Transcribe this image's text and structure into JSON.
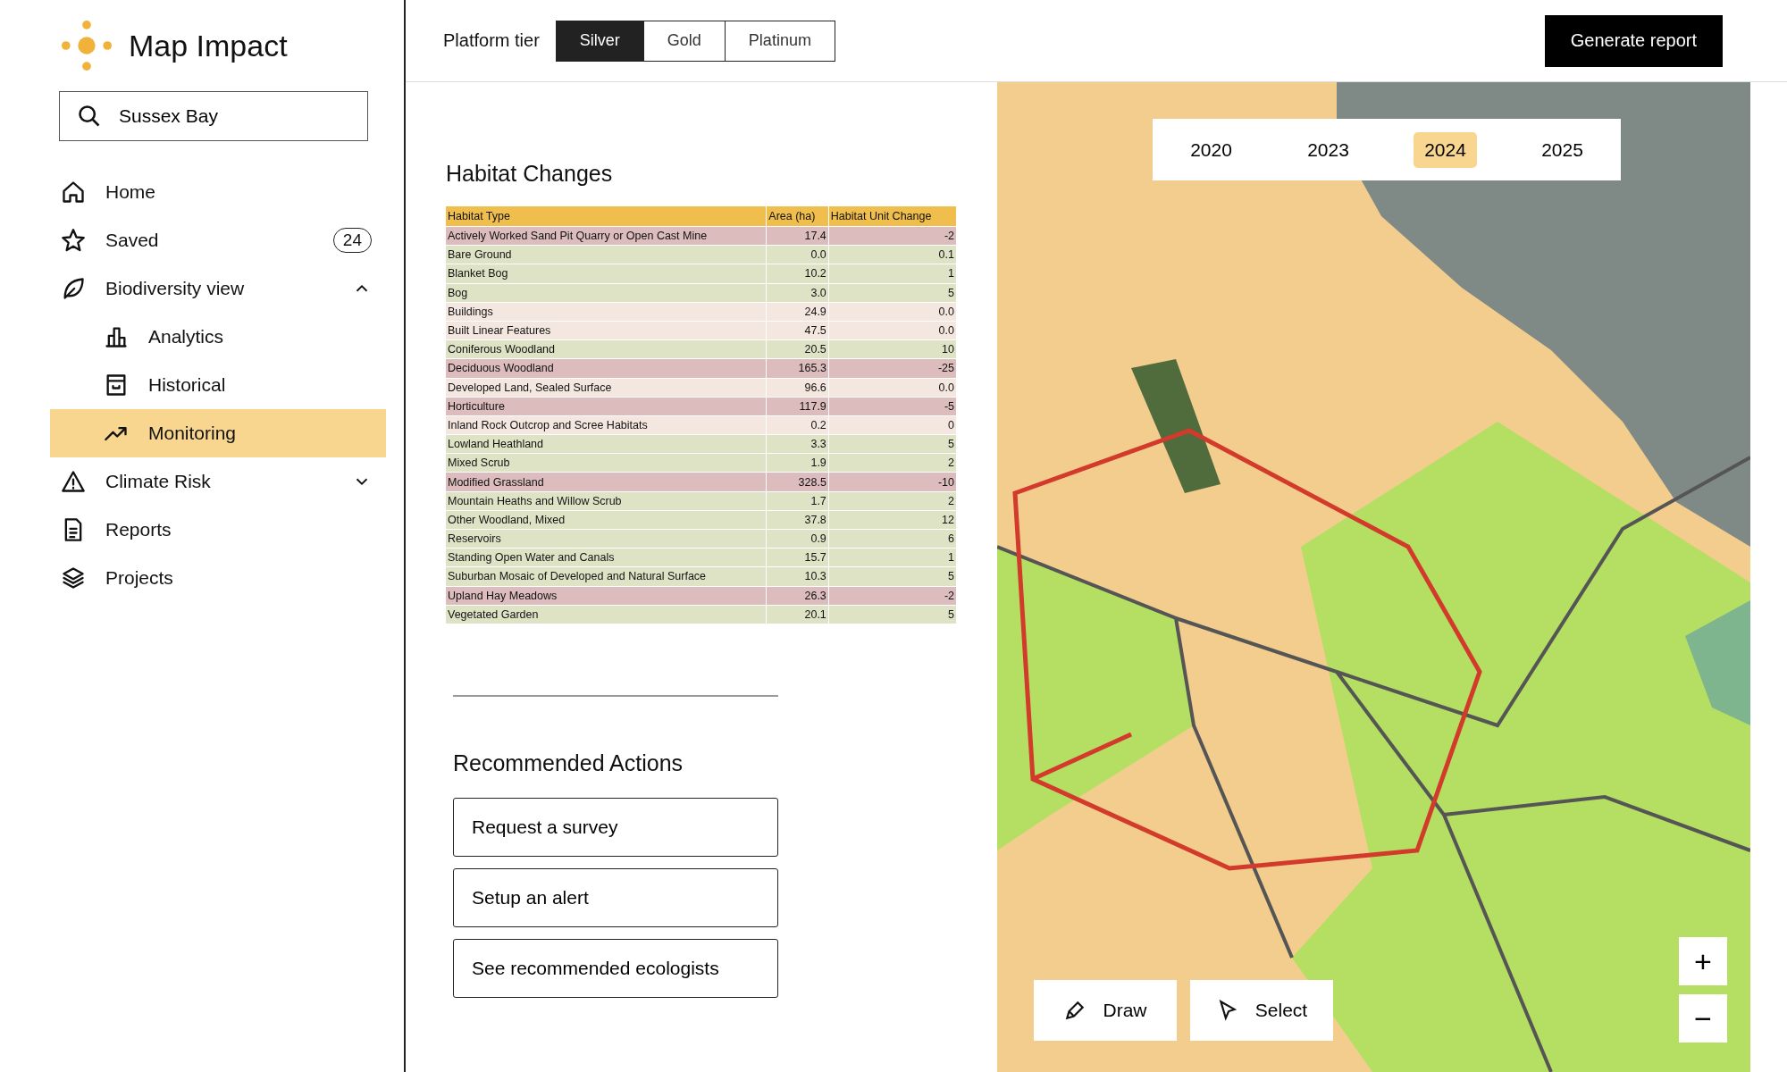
{
  "app": {
    "name": "Map Impact"
  },
  "search": {
    "value": "Sussex Bay"
  },
  "nav": [
    {
      "label": "Home",
      "selected": false
    },
    {
      "label": "Saved",
      "badge": "24",
      "selected": false
    },
    {
      "label": "Biodiversity view",
      "expanded": true,
      "selected": false,
      "children": [
        {
          "label": "Analytics",
          "selected": false
        },
        {
          "label": "Historical",
          "selected": false
        },
        {
          "label": "Monitoring",
          "selected": true
        }
      ]
    },
    {
      "label": "Climate Risk",
      "expanded": false,
      "selected": false
    },
    {
      "label": "Reports",
      "selected": false
    },
    {
      "label": "Projects",
      "selected": false
    }
  ],
  "header": {
    "tier_label": "Platform tier",
    "tiers": [
      {
        "label": "Silver",
        "selected": true
      },
      {
        "label": "Gold",
        "selected": false
      },
      {
        "label": "Platinum",
        "selected": false
      }
    ],
    "action": "Generate report"
  },
  "habitat": {
    "title": "Habitat Changes",
    "columns": [
      "Habitat Type",
      "Area (ha)",
      "Habitat Unit Change"
    ],
    "rows": [
      {
        "cells": [
          "Actively Worked Sand Pit Quarry or Open Cast Mine",
          "17.4",
          "-2"
        ],
        "color": "#dcbcbc"
      },
      {
        "cells": [
          "Bare Ground",
          "0.0",
          "0.1"
        ],
        "color": "#dfe3c6"
      },
      {
        "cells": [
          "Blanket Bog",
          "10.2",
          "1"
        ],
        "color": "#dfe3c6"
      },
      {
        "cells": [
          "Bog",
          "3.0",
          "5"
        ],
        "color": "#dfe3c6"
      },
      {
        "cells": [
          "Buildings",
          "24.9",
          "0.0"
        ],
        "color": "#f4e7e0"
      },
      {
        "cells": [
          "Built Linear Features",
          "47.5",
          "0.0"
        ],
        "color": "#f4e7e0"
      },
      {
        "cells": [
          "Coniferous Woodland",
          "20.5",
          "10"
        ],
        "color": "#dfe3c6"
      },
      {
        "cells": [
          "Deciduous Woodland",
          "165.3",
          "-25"
        ],
        "color": "#dcbcbc"
      },
      {
        "cells": [
          "Developed Land, Sealed Surface",
          "96.6",
          "0.0"
        ],
        "color": "#f4e7e0"
      },
      {
        "cells": [
          "Horticulture",
          "117.9",
          "-5"
        ],
        "color": "#dcbcbc"
      },
      {
        "cells": [
          "Inland Rock Outcrop and Scree Habitats",
          "0.2",
          "0"
        ],
        "color": "#f4e7e0"
      },
      {
        "cells": [
          "Lowland Heathland",
          "3.3",
          "5"
        ],
        "color": "#dfe3c6"
      },
      {
        "cells": [
          "Mixed Scrub",
          "1.9",
          "2"
        ],
        "color": "#dfe3c6"
      },
      {
        "cells": [
          "Modified Grassland",
          "328.5",
          "-10"
        ],
        "color": "#dcbcbc"
      },
      {
        "cells": [
          "Mountain Heaths and Willow Scrub",
          "1.7",
          "2"
        ],
        "color": "#dfe3c6"
      },
      {
        "cells": [
          "Other Woodland, Mixed",
          "37.8",
          "12"
        ],
        "color": "#dfe3c6"
      },
      {
        "cells": [
          "Reservoirs",
          "0.9",
          "6"
        ],
        "color": "#dfe3c6"
      },
      {
        "cells": [
          "Standing Open Water and Canals",
          "15.7",
          "1"
        ],
        "color": "#dfe3c6"
      },
      {
        "cells": [
          "Suburban Mosaic of Developed and Natural Surface",
          "10.3",
          "5"
        ],
        "color": "#dfe3c6"
      },
      {
        "cells": [
          "Upland Hay Meadows",
          "26.3",
          "-2"
        ],
        "color": "#dcbcbc"
      },
      {
        "cells": [
          "Vegetated Garden",
          "20.1",
          "5"
        ],
        "color": "#dfe3c6"
      }
    ]
  },
  "actions": {
    "title": "Recommended Actions",
    "buttons": [
      "Request a survey",
      "Setup an alert",
      "See recommended ecologists"
    ]
  },
  "map": {
    "years": [
      {
        "label": "2020",
        "selected": false
      },
      {
        "label": "2023",
        "selected": false
      },
      {
        "label": "2024",
        "selected": true
      },
      {
        "label": "2025",
        "selected": false
      }
    ],
    "tools": [
      {
        "label": "Draw"
      },
      {
        "label": "Select"
      }
    ],
    "zoom": [
      "+",
      "−"
    ]
  }
}
